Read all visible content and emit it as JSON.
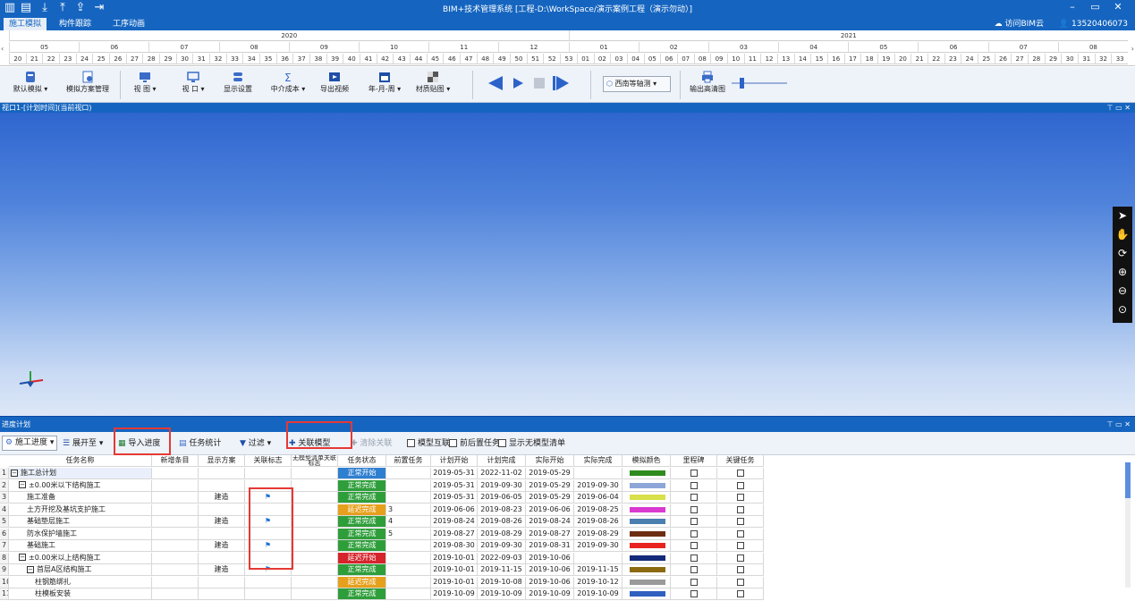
{
  "titlebar": {
    "title": "BIM+技术管理系统 [工程-D:\\WorkSpace/演示案例工程（演示勿动）]",
    "controls": [
      "–",
      "▭",
      "✕"
    ]
  },
  "tabs": [
    {
      "label": "施工模拟",
      "active": true
    },
    {
      "label": "构件跟踪",
      "active": false
    },
    {
      "label": "工序动画",
      "active": false
    }
  ],
  "account": {
    "cloud": "访问BIM云",
    "user": "13520406073"
  },
  "timeline": {
    "years": [
      "2020",
      "2021"
    ],
    "months": [
      "05",
      "06",
      "07",
      "08",
      "09",
      "10",
      "11",
      "12",
      "01",
      "02",
      "03",
      "04",
      "05",
      "06",
      "07",
      "08"
    ],
    "weeks": [
      "20",
      "21",
      "22",
      "23",
      "24",
      "25",
      "26",
      "27",
      "28",
      "29",
      "30",
      "31",
      "32",
      "33",
      "34",
      "35",
      "36",
      "37",
      "38",
      "39",
      "40",
      "41",
      "42",
      "43",
      "44",
      "45",
      "46",
      "47",
      "48",
      "49",
      "50",
      "51",
      "52",
      "53",
      "01",
      "02",
      "03",
      "04",
      "05",
      "06",
      "07",
      "08",
      "09",
      "10",
      "11",
      "12",
      "13",
      "14",
      "15",
      "16",
      "17",
      "18",
      "19",
      "20",
      "21",
      "22",
      "23",
      "24",
      "25",
      "26",
      "27",
      "28",
      "29",
      "30",
      "31",
      "32",
      "33"
    ]
  },
  "toolbar": {
    "default_sim": "默认模拟",
    "sim_manage": "模拟方案管理",
    "view_diagram": "视 图",
    "view_window": "视 口",
    "display_settings": "显示设置",
    "mid_cost": "中介成本",
    "export_video": "导出视频",
    "year_month_week": "年-月-周",
    "material_map": "材质贴图",
    "view_mode": "西南等轴测",
    "export_hd": "输出高清图"
  },
  "viewport": {
    "title": "视口1-[计划时间](当前视口)"
  },
  "schedule": {
    "title": "进度计划",
    "toolbar": {
      "construction_progress": "施工进度",
      "expand_to": "展开至",
      "import_progress": "导入进度",
      "task_stats": "任务统计",
      "filter": "过滤",
      "link_model": "关联模型",
      "clear_link": "清除关联",
      "model_interlink": "模型互联",
      "pre_post_task": "前后置任务",
      "show_unmodeled": "显示无模型清单"
    },
    "columns": [
      "任务名称",
      "新增条目",
      "显示方案",
      "关联标志",
      "无模型清单关联标志",
      "任务状态",
      "前置任务",
      "计划开始",
      "计划完成",
      "实际开始",
      "实际完成",
      "模拟颜色",
      "里程碑",
      "关键任务"
    ],
    "rows": [
      {
        "n": "1",
        "name": "施工总计划",
        "toggle": "−",
        "lvl": 0,
        "scheme": "",
        "flag": "",
        "status": "正常开始",
        "st": "blue",
        "pre": "",
        "ps": "2019-05-31",
        "pf": "2022-11-02",
        "as": "2019-05-29",
        "af": "",
        "color": "#2e8b1e"
      },
      {
        "n": "2",
        "name": "±0.00米以下结构施工",
        "toggle": "−",
        "lvl": 1,
        "scheme": "",
        "flag": "",
        "status": "正常完成",
        "st": "green",
        "pre": "",
        "ps": "2019-05-31",
        "pf": "2019-09-30",
        "as": "2019-05-29",
        "af": "2019-09-30",
        "color": "#8da6d8"
      },
      {
        "n": "3",
        "name": "施工准备",
        "toggle": "",
        "lvl": 2,
        "scheme": "建造",
        "flag": "⚑",
        "status": "正常完成",
        "st": "green",
        "pre": "",
        "ps": "2019-05-31",
        "pf": "2019-06-05",
        "as": "2019-05-29",
        "af": "2019-06-04",
        "color": "#d8e04a"
      },
      {
        "n": "4",
        "name": "土方开挖及基坑支护施工",
        "toggle": "",
        "lvl": 2,
        "scheme": "",
        "flag": "",
        "status": "延迟完成",
        "st": "orange",
        "pre": "3",
        "ps": "2019-06-06",
        "pf": "2019-08-23",
        "as": "2019-06-06",
        "af": "2019-08-25",
        "color": "#d93ad0"
      },
      {
        "n": "5",
        "name": "基础垫层施工",
        "toggle": "",
        "lvl": 2,
        "scheme": "建造",
        "flag": "⚑",
        "status": "正常完成",
        "st": "green",
        "pre": "4",
        "ps": "2019-08-24",
        "pf": "2019-08-26",
        "as": "2019-08-24",
        "af": "2019-08-26",
        "color": "#4a7fb0"
      },
      {
        "n": "6",
        "name": "防水保护墙施工",
        "toggle": "",
        "lvl": 2,
        "scheme": "",
        "flag": "",
        "status": "正常完成",
        "st": "green",
        "pre": "5",
        "ps": "2019-08-27",
        "pf": "2019-08-29",
        "as": "2019-08-27",
        "af": "2019-08-29",
        "color": "#6b2e12"
      },
      {
        "n": "7",
        "name": "基础施工",
        "toggle": "",
        "lvl": 2,
        "scheme": "建造",
        "flag": "⚑",
        "status": "正常完成",
        "st": "green",
        "pre": "",
        "ps": "2019-08-30",
        "pf": "2019-09-30",
        "as": "2019-08-31",
        "af": "2019-09-30",
        "color": "#e8231f"
      },
      {
        "n": "8",
        "name": "±0.00米以上结构施工",
        "toggle": "−",
        "lvl": 1,
        "scheme": "",
        "flag": "",
        "status": "延迟开始",
        "st": "red",
        "pre": "",
        "ps": "2019-10-01",
        "pf": "2022-09-03",
        "as": "2019-10-06",
        "af": "",
        "color": "#142a7a"
      },
      {
        "n": "9",
        "name": "首层A区结构施工",
        "toggle": "−",
        "lvl": 2,
        "scheme": "建造",
        "flag": "⚑",
        "status": "正常完成",
        "st": "green",
        "pre": "",
        "ps": "2019-10-01",
        "pf": "2019-11-15",
        "as": "2019-10-06",
        "af": "2019-11-15",
        "color": "#8c6a10"
      },
      {
        "n": "10",
        "name": "柱钢筋绑扎",
        "toggle": "",
        "lvl": 3,
        "scheme": "",
        "flag": "",
        "status": "延迟完成",
        "st": "orange",
        "pre": "",
        "ps": "2019-10-01",
        "pf": "2019-10-08",
        "as": "2019-10-06",
        "af": "2019-10-12",
        "color": "#9a9a9a"
      },
      {
        "n": "11",
        "name": "柱模板安装",
        "toggle": "",
        "lvl": 3,
        "scheme": "",
        "flag": "",
        "status": "正常完成",
        "st": "green",
        "pre": "",
        "ps": "2019-10-09",
        "pf": "2019-10-09",
        "as": "2019-10-09",
        "af": "2019-10-09",
        "color": "#3060c0"
      }
    ]
  }
}
